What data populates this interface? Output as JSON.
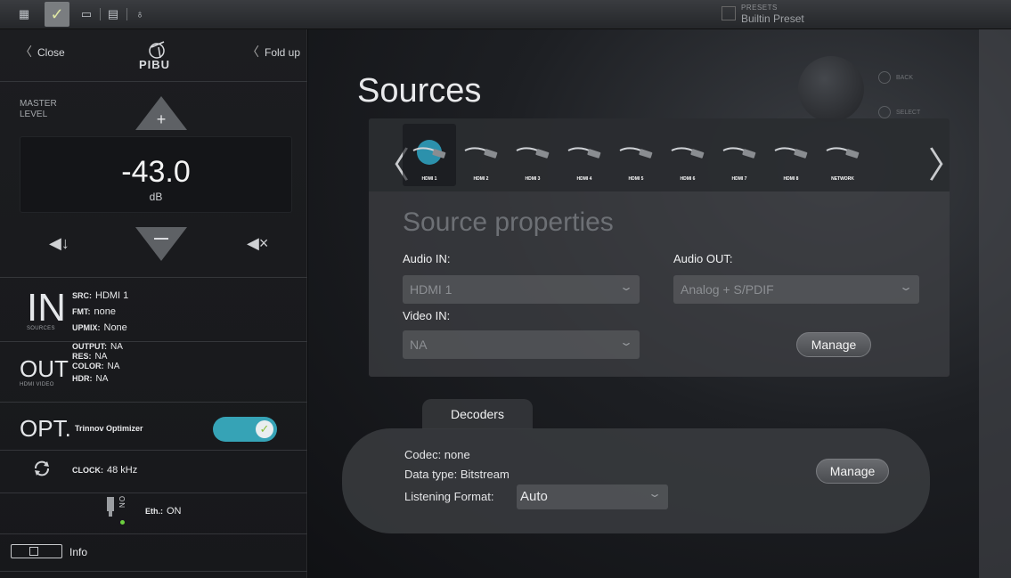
{
  "topbar": {
    "presets_label": "PRESETS",
    "preset_value": "Builtin Preset"
  },
  "left": {
    "close_label": "Close",
    "fold_label": "Fold up",
    "logo_text": "PIBU",
    "master_label_line1": "MASTER",
    "master_label_line2": "LEVEL",
    "volume_value": "-43.0",
    "volume_unit": "dB",
    "in": {
      "big": "IN",
      "caption": "SOURCES",
      "src_key": "SRC:",
      "src_val": "HDMI 1",
      "fmt_key": "FMT:",
      "fmt_val": "none",
      "upmix_key": "UPMIX:",
      "upmix_val": "None"
    },
    "out": {
      "big": "OUT",
      "caption": "HDMI VIDEO",
      "output_key": "OUTPUT:",
      "output_val": "NA",
      "res_key": "RES:",
      "res_val": "NA",
      "color_key": "COLOR:",
      "color_val": "NA",
      "hdr_key": "HDR:",
      "hdr_val": "NA"
    },
    "opt": {
      "big": "OPT.",
      "label": "Trinnov Optimizer",
      "enabled": true
    },
    "clock_key": "CLOCK:",
    "clock_val": "48 kHz",
    "eth_side": "ON",
    "eth_key": "Eth.:",
    "eth_val": "ON",
    "info_label": "Info"
  },
  "main": {
    "title": "Sources",
    "device_labels": [
      "BACK",
      "SELECT"
    ],
    "sources": [
      "HDMI 1",
      "HDMI 2",
      "HDMI 3",
      "HDMI 4",
      "HDMI 5",
      "HDMI 6",
      "HDMI 7",
      "HDMI 8",
      "NETWORK"
    ],
    "selected_source": "HDMI 1",
    "props_title": "Source properties",
    "audio_in_label": "Audio IN:",
    "audio_in_value": "HDMI 1",
    "audio_out_label": "Audio OUT:",
    "audio_out_value": "Analog + S/PDIF",
    "video_in_label": "Video IN:",
    "video_in_value": "NA",
    "manage_label": "Manage",
    "decoders_tab": "Decoders",
    "codec": "Codec: none",
    "data_type": "Data type: Bitstream",
    "listening_label": "Listening Format:",
    "listening_value": "Auto",
    "dec_manage_label": "Manage"
  },
  "colors": {
    "accent": "#36a3b6",
    "selected_glow": "#2fa6c4",
    "check": "#8bbf3a"
  }
}
